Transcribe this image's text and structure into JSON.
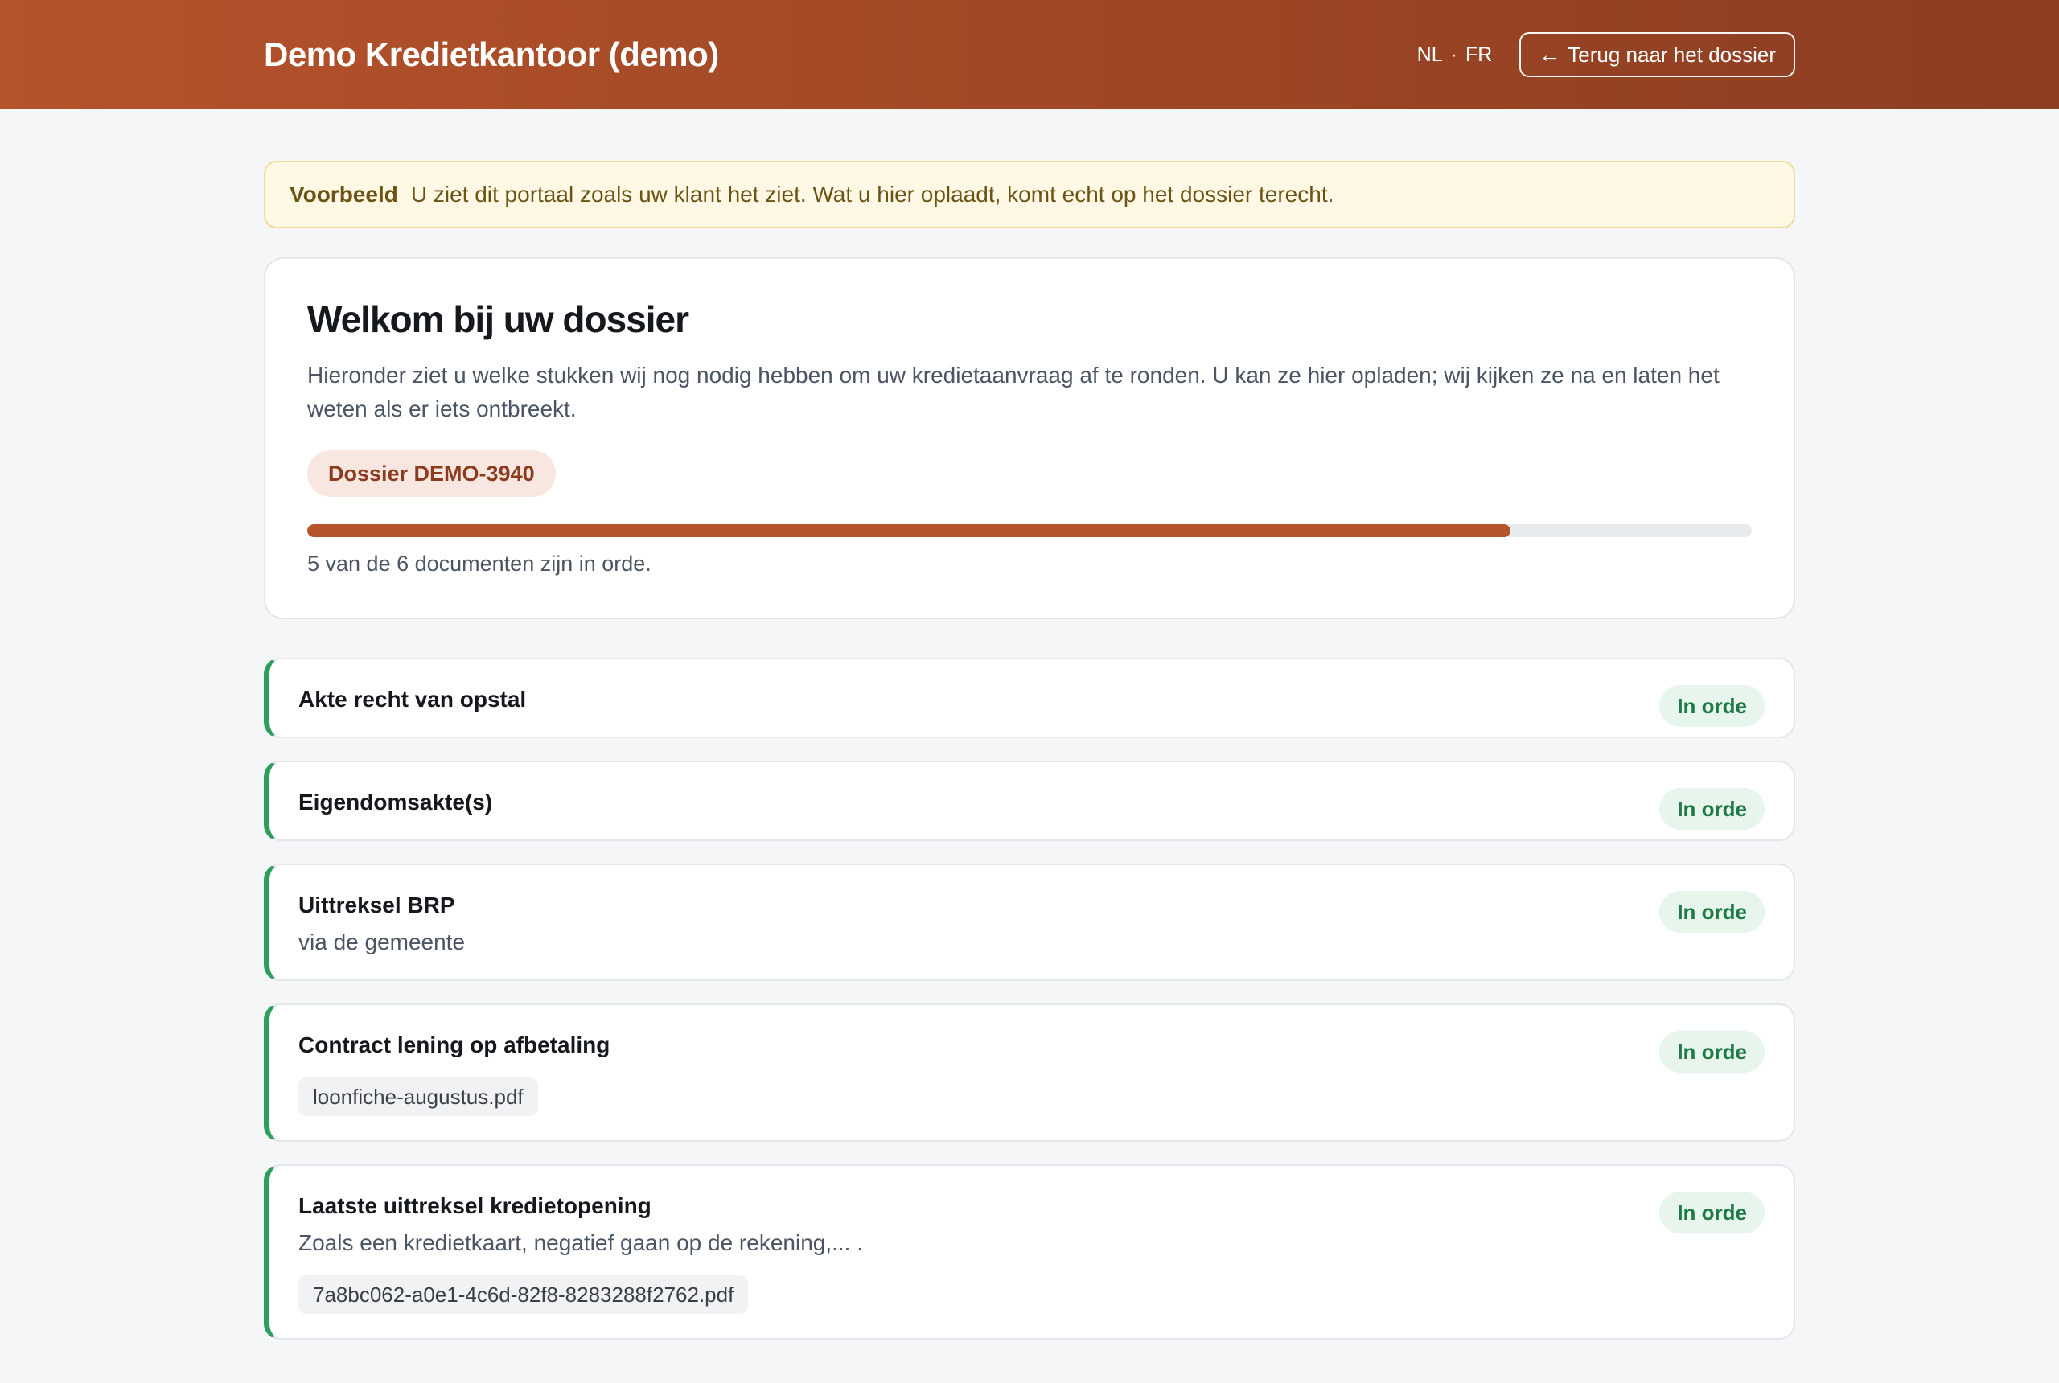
{
  "header": {
    "brand": "Demo Kredietkantoor (demo)",
    "lang_nl": "NL",
    "lang_sep": "·",
    "lang_fr": "FR",
    "back_arrow": "←",
    "back_label": "Terug naar het dossier"
  },
  "notice": {
    "tag": "Voorbeeld",
    "text": "U ziet dit portaal zoals uw klant het ziet. Wat u hier oplaadt, komt echt op het dossier terecht.",
    "colors": {
      "background": "#fef8e4",
      "border": "#f1dc94",
      "text": "#6b5314"
    }
  },
  "welcome": {
    "title": "Welkom bij uw dossier",
    "intro": "Hieronder ziet u welke stukken wij nog nodig hebben om uw kredietaanvraag af te ronden. U kan ze hier opladen; wij kijken ze na en laten het weten als er iets ontbreekt.",
    "dossier_label": "Dossier DEMO-3940",
    "progress_fraction": 0.833,
    "progress_text": "5 van de 6 documenten zijn in orde."
  },
  "documents": [
    {
      "title": "Akte recht van opstal",
      "status": "In orde"
    },
    {
      "title": "Eigendomsakte(s)",
      "status": "In orde"
    },
    {
      "title": "Uittreksel BRP",
      "subtitle": "via de gemeente",
      "status": "In orde"
    },
    {
      "title": "Contract lening op afbetaling",
      "file": "loonfiche-augustus.pdf",
      "status": "In orde"
    },
    {
      "title": "Laatste uittreksel kredietopening",
      "subtitle": "Zoals een kredietkaart, negatief gaan op de rekening,... .",
      "file": "7a8bc062-a0e1-4c6d-82f8-8283288f2762.pdf",
      "status": "In orde"
    }
  ],
  "colors": {
    "brand": "#b5532b",
    "status_ok": "#2e9e5f",
    "status_ok_text": "#1e7b45",
    "page_background": "#f5f6f8"
  }
}
